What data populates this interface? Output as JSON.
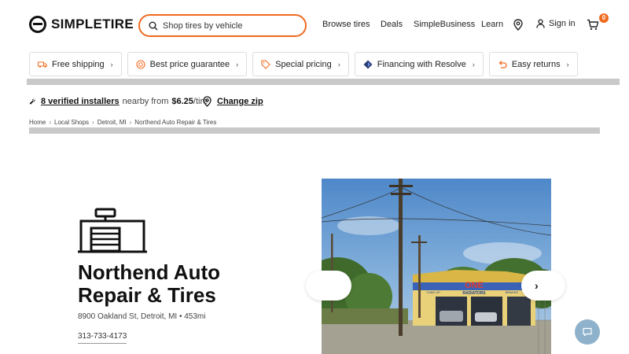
{
  "header": {
    "logo_text": "SIMPLETIRE",
    "search_placeholder": "Shop tires by vehicle",
    "nav": [
      "Browse tires",
      "Deals",
      "SimpleBusiness",
      "Learn"
    ],
    "signin_label": "Sign in",
    "cart_count": "0"
  },
  "pills": [
    {
      "label": "Free shipping",
      "icon": "truck-icon"
    },
    {
      "label": "Best price guarantee",
      "icon": "badge-icon"
    },
    {
      "label": "Special pricing",
      "icon": "tag-icon"
    },
    {
      "label": "Financing with Resolve",
      "icon": "resolve-icon"
    },
    {
      "label": "Easy returns",
      "icon": "return-icon"
    }
  ],
  "installers": {
    "link_text": "8 verified installers",
    "nearby_text": "nearby from",
    "price": "$6.25",
    "unit": "/tire",
    "change_zip": "Change zip"
  },
  "breadcrumb": [
    "Home",
    "Local Shops",
    "Detroit, MI",
    "Northend Auto Repair & Tires"
  ],
  "shop": {
    "title": "Northend Auto Repair & Tires",
    "address": "8900 Oakland St, Detroit, MI • 453mi",
    "phone": "313-733-4173",
    "sign_text": "ONE",
    "sign_sub": "RADIATORS",
    "sign_left": "TUNE UP",
    "sign_right": "BRAKES"
  },
  "colors": {
    "accent": "#f06a1f",
    "chat": "#8fb2cc"
  }
}
